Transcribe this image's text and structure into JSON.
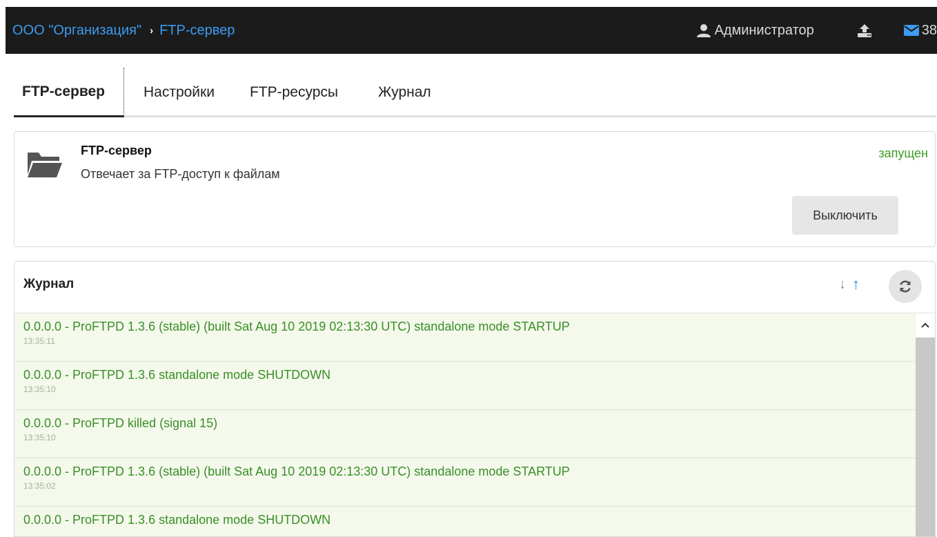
{
  "topbar": {
    "breadcrumb": [
      "ООО \"Организация\"",
      "FTP-сервер"
    ],
    "separator": "›",
    "user_name": "Администратор",
    "mail_count": "38",
    "icons": [
      "user-icon",
      "upload-icon",
      "envelope-icon"
    ],
    "colors": {
      "background": "#1b1b1b",
      "link": "#3d9bf0"
    }
  },
  "tabs": [
    {
      "label": "FTP-сервер",
      "active": true
    },
    {
      "label": "Настройки"
    },
    {
      "label": "FTP-ресурсы"
    },
    {
      "label": "Журнал"
    }
  ],
  "service": {
    "icon": "folder-open-icon",
    "title": "FTP-сервер",
    "description": "Отвечает за FTP-доступ к файлам",
    "status": "запущен",
    "status_color": "#3a9d23",
    "button_label": "Выключить"
  },
  "log": {
    "title": "Журнал",
    "controls": [
      "sort-down-icon",
      "sort-up-icon",
      "refresh-icon"
    ],
    "entries": [
      {
        "message": "0.0.0.0 - ProFTPD 1.3.6 (stable) (built Sat Aug 10 2019 02:13:30 UTC) standalone mode STARTUP",
        "time": "13:35:11"
      },
      {
        "message": "0.0.0.0 - ProFTPD 1.3.6 standalone mode SHUTDOWN",
        "time": "13:35:10"
      },
      {
        "message": "0.0.0.0 - ProFTPD killed (signal 15)",
        "time": "13:35:10"
      },
      {
        "message": "0.0.0.0 - ProFTPD 1.3.6 (stable) (built Sat Aug 10 2019 02:13:30 UTC) standalone mode STARTUP",
        "time": "13:35:02"
      },
      {
        "message": "0.0.0.0 - ProFTPD 1.3.6 standalone mode SHUTDOWN",
        "time": ""
      }
    ],
    "colors": {
      "entry_text": "#3a8e26",
      "entry_bg": "#f4f9ec"
    }
  }
}
